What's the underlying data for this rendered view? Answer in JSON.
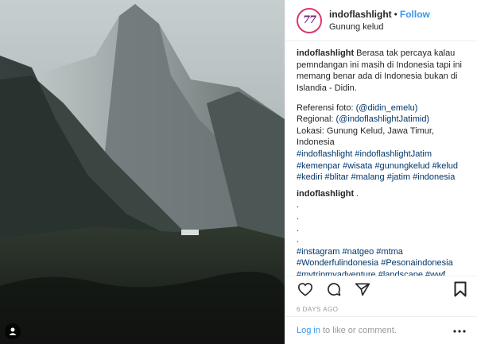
{
  "header": {
    "avatar_initials": "77",
    "username": "indoflashlight",
    "separator": "•",
    "follow_label": "Follow",
    "location": "Gunung kelud"
  },
  "caption": {
    "username": "indoflashlight",
    "text": "Berasa tak percaya kalau pemndangan ini masih di Indonesia tapi ini memang benar ada di Indonesia bukan di Islandia - Didin.",
    "ref_label": "Referensi foto:",
    "ref_handle": "(@didin_emelu)",
    "regional_label": "Regional:",
    "regional_handle": "(@indoflashlightJatimid)",
    "location_text": "Lokasi: Gunung Kelud, Jawa Timur, Indonesia",
    "hashtags": "#indoflashlight #indoflashlightJatim #kemenpar #wisata #gunungkelud #kelud #kediri #blitar #malang #jatim #indonesia"
  },
  "comment": {
    "username": "indoflashlight",
    "suffix": " .",
    "dot1": ".",
    "dot2": ".",
    "dot3": ".",
    "dot4": ".",
    "hashtags": "#instagram #natgeo #mtma #Wonderfulindonesia #Pesonaindonesia #mytripmyadventure #landscape #wwf #earth #paradise #amazingplace"
  },
  "timestamp": "6 DAYS AGO",
  "login": {
    "link": "Log in",
    "text": "to like or comment."
  },
  "colors": {
    "link": "#3897f0",
    "hashtag": "#003569",
    "avatar_ring": "#e0356e"
  },
  "icons": [
    "heart-icon",
    "comment-icon",
    "share-icon",
    "bookmark-icon",
    "more-icon",
    "user-tag-icon"
  ]
}
